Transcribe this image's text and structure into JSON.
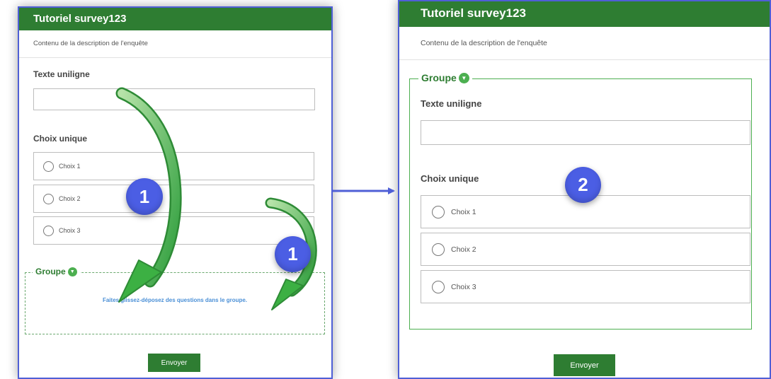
{
  "left_panel": {
    "header_title": "Tutoriel survey123",
    "description": "Contenu de la description de l'enquête",
    "text_question_label": "Texte uniligne",
    "text_input_value": "",
    "single_choice_label": "Choix unique",
    "choices": [
      "Choix 1",
      "Choix 2",
      "Choix 3"
    ],
    "group_title": "Groupe",
    "group_hint": "Faites glissez-déposez des questions dans le groupe.",
    "submit_label": "Envoyer"
  },
  "right_panel": {
    "header_title": "Tutoriel survey123",
    "description": "Contenu de la description de l'enquête",
    "group_title": "Groupe",
    "text_question_label": "Texte uniligne",
    "text_input_value": "",
    "single_choice_label": "Choix unique",
    "choices": [
      "Choix 1",
      "Choix 2",
      "Choix 3"
    ],
    "submit_label": "Envoyer"
  },
  "annotations": {
    "step_badges": [
      "1",
      "1",
      "2"
    ],
    "badge_color": "#4b5ee4",
    "drag_arrow_color": "#3cb043",
    "transition_arrow_color": "#4f5fd6",
    "icons": [
      "chevron-down-icon",
      "radio-icon",
      "drag-arrow-icon",
      "right-arrow-icon"
    ]
  },
  "colors": {
    "header_bg": "#2e7d32",
    "accent": "#4caf50",
    "hint_text": "#4a8fd6",
    "panel_border": "#4f5fd6"
  }
}
